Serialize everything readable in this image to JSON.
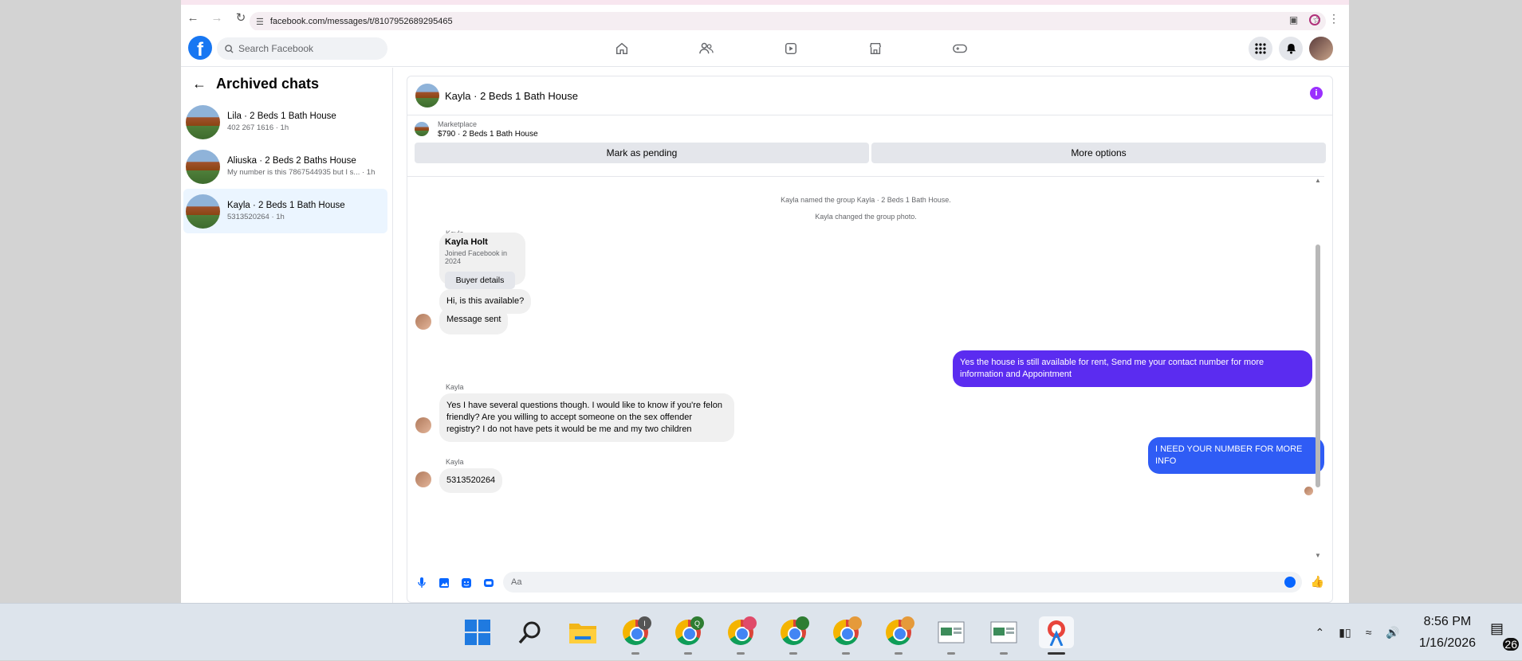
{
  "browser": {
    "url": "facebook.com/messages/t/8107952689295465"
  },
  "header": {
    "search_placeholder": "Search Facebook",
    "logo_text": "f"
  },
  "sidebar": {
    "title": "Archived chats",
    "chats": [
      {
        "name": "Lila · 2 Beds 1 Bath House",
        "preview": "402 267 1616 · 1h"
      },
      {
        "name": "Aliuska · 2 Beds 2 Baths House",
        "preview": "My number is this 7867544935 but I s... · 1h"
      },
      {
        "name": "Kayla · 2 Beds 1 Bath House",
        "preview": "5313520264 · 1h"
      }
    ]
  },
  "conversation": {
    "title": "Kayla · 2 Beds 1 Bath House",
    "marketplace_label": "Marketplace",
    "listing": "$790 · 2 Beds 1 Bath House",
    "mark_pending": "Mark as pending",
    "more_options": "More options",
    "system_1": "Kayla named the group Kayla · 2 Beds 1 Bath House.",
    "system_2": "Kayla changed the group photo.",
    "sender_name": "Kayla",
    "card_name": "Kayla Holt",
    "card_sub": "Joined Facebook in 2024",
    "card_button": "Buyer details",
    "msg_available": "Hi, is this available?",
    "msg_sent": "Message sent",
    "reply_1": "Yes the house is still available for rent, Send me your contact number for more information and Appointment",
    "msg_questions": "Yes I have several questions though. I would like to know if you're felon friendly? Are you willing to accept someone on the sex offender registry? I do not have pets it would be me and my two children",
    "reply_2": "I NEED YOUR NUMBER FOR MORE INFO",
    "msg_number": "5313520264",
    "composer_placeholder": "Aa"
  },
  "taskbar": {
    "time": "8:56 PM",
    "date": "1/16/2026",
    "notification_count": "26",
    "badges": [
      "I",
      "Q"
    ]
  },
  "colors": {
    "fb_blue": "#1877f2",
    "outgoing_bubble": "#5b2cf0",
    "outgoing_bubble_2": "#2f5cf5",
    "info_icon": "#9b30ff"
  }
}
